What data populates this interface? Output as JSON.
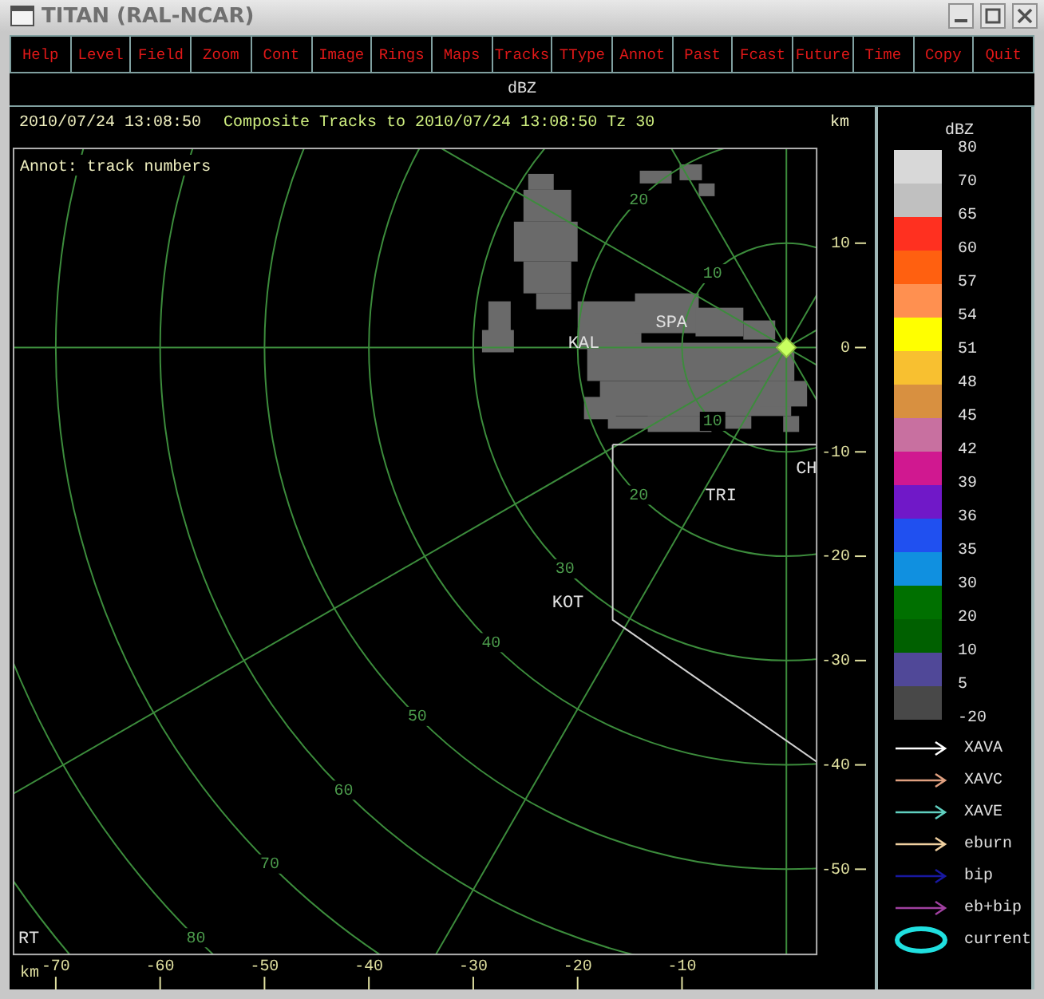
{
  "window": {
    "title": "TITAN (RAL-NCAR)"
  },
  "menu": [
    "Help",
    "Level",
    "Field",
    "Zoom",
    "Cont",
    "Image",
    "Rings",
    "Maps",
    "Tracks",
    "TType",
    "Annot",
    "Past",
    "Fcast",
    "Future",
    "Time",
    "Copy",
    "Quit"
  ],
  "field_bar": {
    "label": "dBZ"
  },
  "plot": {
    "time": "2010/07/24 13:08:50",
    "title": "Composite Tracks to 2010/07/24 13:08:50 Tz 30",
    "units": "km",
    "annotation": "Annot: track numbers",
    "ring_labels": [
      "10",
      "20",
      "10",
      "20",
      "30",
      "40",
      "50",
      "60",
      "70",
      "80"
    ],
    "places": [
      "KAL",
      "SPA",
      "TRI",
      "KOT",
      "CH",
      "RT"
    ],
    "y_axis": [
      "10",
      "0",
      "-10",
      "-20",
      "-30",
      "-40",
      "-50"
    ],
    "x_axis_units": "km",
    "x_axis": [
      "-70",
      "-60",
      "-50",
      "-40",
      "-30",
      "-20",
      "-10"
    ]
  },
  "legend": {
    "title": "dBZ",
    "scale_labels": [
      "80",
      "70",
      "65",
      "60",
      "57",
      "54",
      "51",
      "48",
      "45",
      "42",
      "39",
      "36",
      "35",
      "30",
      "20",
      "10",
      "5",
      "-20"
    ],
    "bands": [
      {
        "color": "#d8d8d8"
      },
      {
        "color": "#c0c0c0"
      },
      {
        "color": "#ff3020"
      },
      {
        "color": "#ff6010"
      },
      {
        "color": "#ff9050"
      },
      {
        "color": "#ffff00"
      },
      {
        "color": "#f8c030"
      },
      {
        "color": "#d89040"
      },
      {
        "color": "#c870a0"
      },
      {
        "color": "#d01890"
      },
      {
        "color": "#7018c8"
      },
      {
        "color": "#2050f0"
      },
      {
        "color": "#1090e0"
      },
      {
        "color": "#007000"
      },
      {
        "color": "#006000"
      },
      {
        "color": "#504898"
      },
      {
        "color": "#484848"
      }
    ],
    "tracks": [
      {
        "kind": "arrow",
        "label": "XAVA",
        "color": "#ffffff"
      },
      {
        "kind": "arrow",
        "label": "XAVC",
        "color": "#e0a080"
      },
      {
        "kind": "arrow",
        "label": "XAVE",
        "color": "#60d0c0"
      },
      {
        "kind": "arrow",
        "label": "eburn",
        "color": "#f0d0a0"
      },
      {
        "kind": "arrow",
        "label": "bip",
        "color": "#1818a0"
      },
      {
        "kind": "arrow",
        "label": "eb+bip",
        "color": "#a040a0"
      },
      {
        "kind": "ellipse",
        "label": "current",
        "color": "#20e0e0"
      }
    ]
  }
}
